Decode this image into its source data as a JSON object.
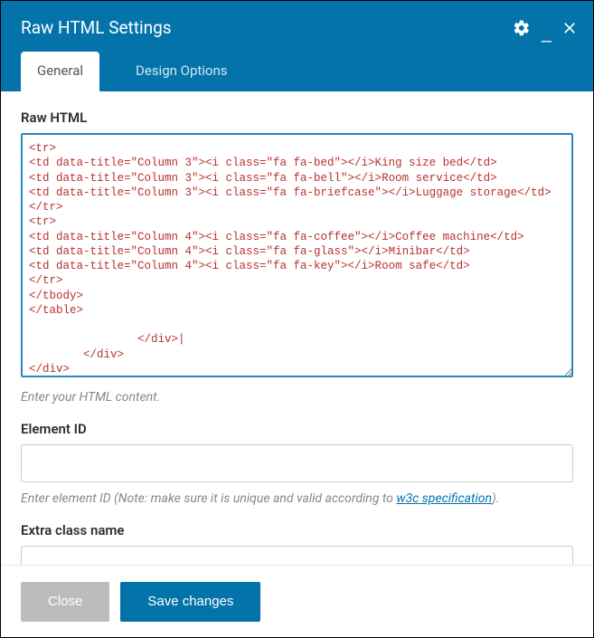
{
  "header": {
    "title": "Raw HTML Settings"
  },
  "tabs": {
    "general": "General",
    "design": "Design Options"
  },
  "fields": {
    "rawhtml_label": "Raw HTML",
    "rawhtml_value": "<tr>\n<td data-title=\"Column 3\"><i class=\"fa fa-bed\"></i>King size bed</td>\n<td data-title=\"Column 3\"><i class=\"fa fa-bell\"></i>Room service</td>\n<td data-title=\"Column 3\"><i class=\"fa fa-briefcase\"></i>Luggage storage</td>\n</tr>\n<tr>\n<td data-title=\"Column 4\"><i class=\"fa fa-coffee\"></i>Coffee machine</td>\n<td data-title=\"Column 4\"><i class=\"fa fa-glass\"></i>Minibar</td>\n<td data-title=\"Column 4\"><i class=\"fa fa-key\"></i>Room safe</td>\n</tr>\n</tbody>\n</table>\n\n                </div>|\n        </div>\n</div>",
    "rawhtml_help": "Enter your HTML content.",
    "elementid_label": "Element ID",
    "elementid_value": "",
    "elementid_help_pre": "Enter element ID (Note: make sure it is unique and valid according to ",
    "elementid_help_link": "w3c specification",
    "elementid_help_post": ").",
    "extraclass_label": "Extra class name"
  },
  "footer": {
    "close": "Close",
    "save": "Save changes"
  }
}
